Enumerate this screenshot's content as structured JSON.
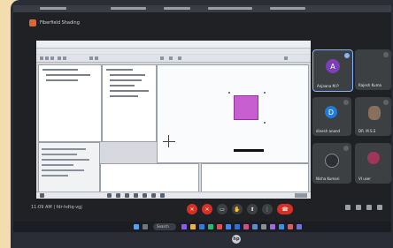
{
  "presentation": {
    "title": "Fiberfield Shading"
  },
  "participants": [
    {
      "name": "Anjaana M P",
      "initial": "A",
      "color": "#7b3fb8",
      "active": true
    },
    {
      "name": "Rajesh Kuma",
      "initial": "",
      "color": "#6b6f75",
      "active": false
    },
    {
      "name": "dinesh anand",
      "initial": "D",
      "color": "#1f7ad8",
      "active": false
    },
    {
      "name": "DR. M.S.S",
      "initial": "",
      "color": "#8a6f5a",
      "active": false
    },
    {
      "name": "Nisha Kumari",
      "initial": "",
      "color": "#2c2f33",
      "active": false
    },
    {
      "name": "VI user",
      "initial": "",
      "color": "#a0355a",
      "active": false
    }
  ],
  "meeting": {
    "time_code": "11:09 AM | fdr-hdtq-vgj"
  },
  "controls": {
    "mic_label": "mic",
    "cam_label": "cam",
    "end_label": "end"
  },
  "taskbar": {
    "search_label": "Search"
  },
  "colors": {
    "square": "#c85fd1",
    "end_call": "#d93025"
  },
  "brand": {
    "laptop_logo": "hp"
  }
}
